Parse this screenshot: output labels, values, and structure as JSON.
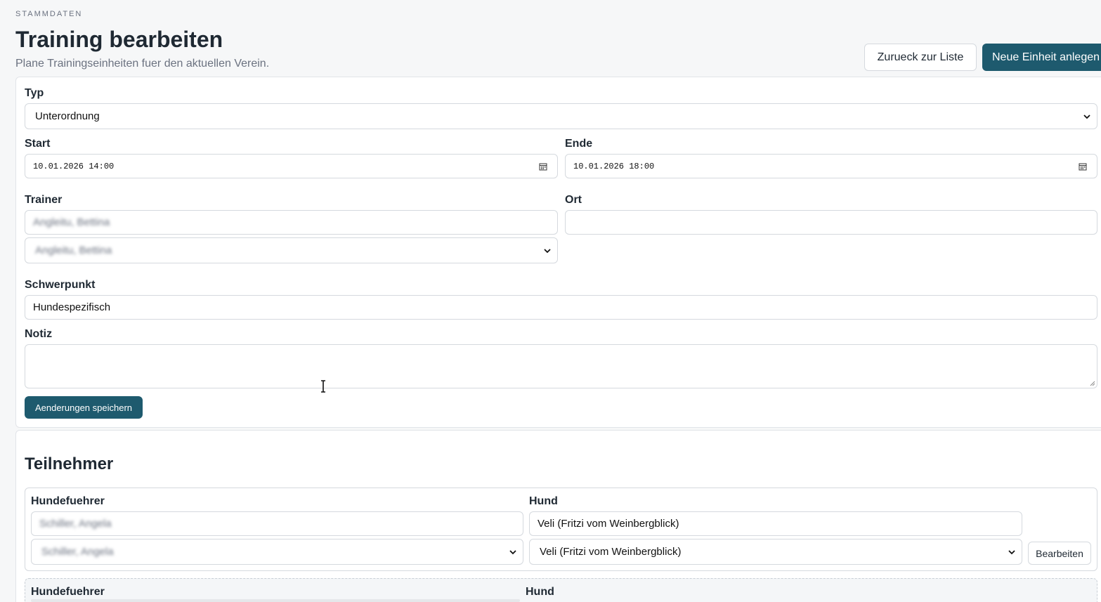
{
  "header": {
    "eyebrow": "STAMMDATEN",
    "title": "Training bearbeiten",
    "subtitle": "Plane Trainingseinheiten fuer den aktuellen Verein.",
    "back_button": "Zurueck zur Liste",
    "new_button": "Neue Einheit anlegen"
  },
  "form": {
    "type": {
      "label": "Typ",
      "value": "Unterordnung"
    },
    "start": {
      "label": "Start",
      "value": "10.01.2026 14:00"
    },
    "end": {
      "label": "Ende",
      "value": "10.01.2026 18:00"
    },
    "trainer": {
      "label": "Trainer",
      "search_value": "Angleitu, Bettina",
      "select_value": "Angleitu, Bettina"
    },
    "location": {
      "label": "Ort",
      "value": ""
    },
    "focus": {
      "label": "Schwerpunkt",
      "value": "Hundespezifisch"
    },
    "note": {
      "label": "Notiz",
      "value": ""
    },
    "save_button": "Aenderungen speichern"
  },
  "participants": {
    "title": "Teilnehmer",
    "rows": [
      {
        "handler_label": "Hundefuehrer",
        "handler_search": "Schiller, Angela",
        "handler_select": "Schiller, Angela",
        "dog_label": "Hund",
        "dog_search": "Veli (Fritzi vom Weinbergblick)",
        "dog_select": "Veli (Fritzi vom Weinbergblick)",
        "edit_button": "Bearbeiten"
      },
      {
        "handler_label": "Hundefuehrer",
        "dog_label": "Hund"
      }
    ]
  }
}
